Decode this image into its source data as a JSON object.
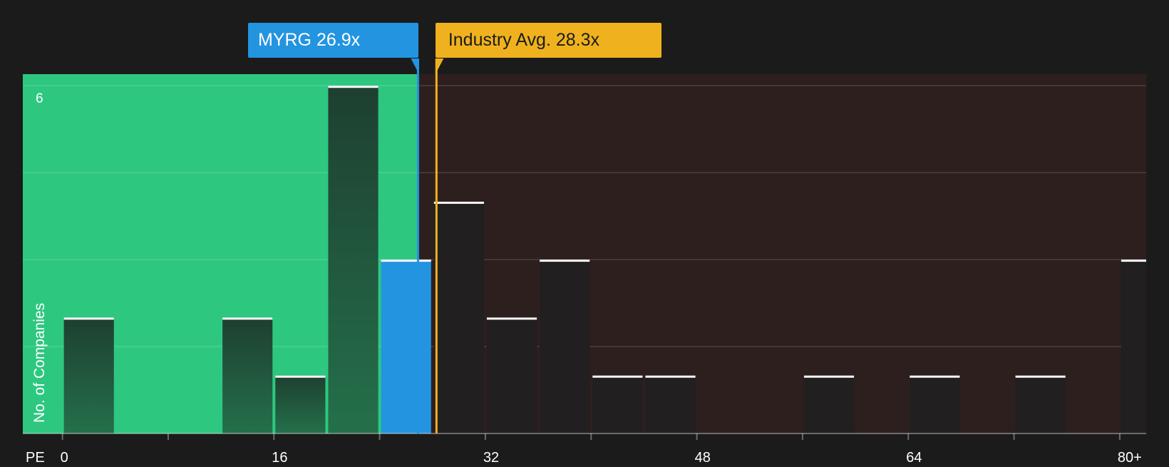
{
  "colors": {
    "background": "#1b1b1b",
    "undervalued_zone": "#2ec780",
    "overvalued_zone": "#2e1f1f",
    "company": "#2394e0",
    "industry": "#efb21e",
    "bar_in_green": "#1f4a35",
    "bar_in_red": "#211f1f",
    "cap": "#ffffff"
  },
  "company_flag": {
    "ticker": "MYRG",
    "value": 26.9,
    "label": "MYRG 26.9x"
  },
  "industry_flag": {
    "value": 28.3,
    "label": "Industry Avg. 28.3x"
  },
  "chart_data": {
    "type": "bar",
    "title": "",
    "xlabel": "PE",
    "ylabel": "No. of Companies",
    "x_ticks": [
      "0",
      "16",
      "32",
      "48",
      "64",
      "80+"
    ],
    "y_ticks": [
      "6"
    ],
    "xlim": [
      -3,
      82
    ],
    "ylim": [
      0,
      6.2
    ],
    "bin_width": 4,
    "bins": [
      {
        "start": 0,
        "count": 2
      },
      {
        "start": 4,
        "count": 0
      },
      {
        "start": 8,
        "count": 0
      },
      {
        "start": 12,
        "count": 2
      },
      {
        "start": 16,
        "count": 1
      },
      {
        "start": 20,
        "count": 6
      },
      {
        "start": 24,
        "count": 3,
        "highlight": true
      },
      {
        "start": 28,
        "count": 4
      },
      {
        "start": 32,
        "count": 2
      },
      {
        "start": 36,
        "count": 3
      },
      {
        "start": 40,
        "count": 1
      },
      {
        "start": 44,
        "count": 1
      },
      {
        "start": 48,
        "count": 0
      },
      {
        "start": 52,
        "count": 0
      },
      {
        "start": 56,
        "count": 1
      },
      {
        "start": 60,
        "count": 0
      },
      {
        "start": 64,
        "count": 1
      },
      {
        "start": 68,
        "count": 0
      },
      {
        "start": 72,
        "count": 1
      },
      {
        "start": 76,
        "count": 0
      },
      {
        "start": 80,
        "count": 3
      }
    ]
  }
}
